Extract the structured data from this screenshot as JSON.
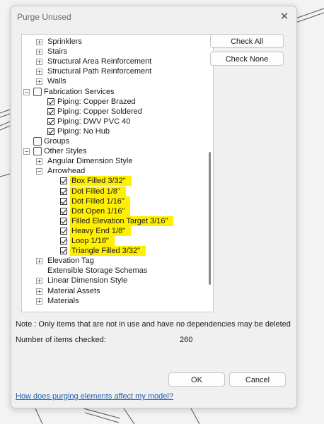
{
  "dialog": {
    "title": "Purge Unused",
    "close_glyph": "✕",
    "buttons": {
      "check_all": "Check All",
      "check_none": "Check None",
      "ok": "OK",
      "cancel": "Cancel"
    },
    "note": "Note : Only items that are not in use and have no dependencies may be deleted",
    "count_label": "Number of items checked:",
    "count_value": "260",
    "help_link": "How does purging elements affect my model?",
    "highlight_color": "#ffef00"
  },
  "tree": {
    "items": [
      {
        "label": "Sprinklers",
        "level": 1,
        "expander": "+",
        "checkbox": "none",
        "icon": "",
        "highlight": false
      },
      {
        "label": "Stairs",
        "level": 1,
        "expander": "+",
        "checkbox": "none",
        "icon": "",
        "highlight": false
      },
      {
        "label": "Structural Area Reinforcement",
        "level": 1,
        "expander": "+",
        "checkbox": "none",
        "icon": "",
        "highlight": false
      },
      {
        "label": "Structural Path Reinforcement",
        "level": 1,
        "expander": "+",
        "checkbox": "none",
        "icon": "",
        "highlight": false
      },
      {
        "label": "Walls",
        "level": 1,
        "expander": "+",
        "checkbox": "none",
        "icon": "",
        "highlight": false
      },
      {
        "label": "Fabrication Services",
        "level": 0,
        "expander": "-",
        "checkbox": "none",
        "icon": "fabrication-icon",
        "highlight": false
      },
      {
        "label": "Piping: Copper Brazed",
        "level": 1,
        "expander": "",
        "checkbox": "checked",
        "icon": "",
        "highlight": false
      },
      {
        "label": "Piping: Copper Soldered",
        "level": 1,
        "expander": "",
        "checkbox": "checked",
        "icon": "",
        "highlight": false
      },
      {
        "label": "Piping: DWV PVC 40",
        "level": 1,
        "expander": "",
        "checkbox": "checked",
        "icon": "",
        "highlight": false
      },
      {
        "label": "Piping: No Hub",
        "level": 1,
        "expander": "",
        "checkbox": "checked",
        "icon": "",
        "highlight": false
      },
      {
        "label": "Groups",
        "level": 0,
        "expander": "",
        "checkbox": "none",
        "icon": "groups-icon",
        "highlight": false
      },
      {
        "label": "Other Styles",
        "level": 0,
        "expander": "-",
        "checkbox": "none",
        "icon": "styles-icon",
        "highlight": false
      },
      {
        "label": "Angular Dimension Style",
        "level": 1,
        "expander": "+",
        "checkbox": "none",
        "icon": "",
        "highlight": false
      },
      {
        "label": "Arrowhead",
        "level": 1,
        "expander": "-",
        "checkbox": "none",
        "icon": "",
        "highlight": false
      },
      {
        "label": "Box Filled 3/32\"",
        "level": 2,
        "expander": "",
        "checkbox": "checked",
        "icon": "",
        "highlight": true
      },
      {
        "label": "Dot Filled 1/8\"",
        "level": 2,
        "expander": "",
        "checkbox": "checked",
        "icon": "",
        "highlight": true
      },
      {
        "label": "Dot Filled 1/16\"",
        "level": 2,
        "expander": "",
        "checkbox": "checked",
        "icon": "",
        "highlight": true
      },
      {
        "label": "Dot Open 1/16\"",
        "level": 2,
        "expander": "",
        "checkbox": "checked",
        "icon": "",
        "highlight": true
      },
      {
        "label": "Filled Elevation Target 3/16\"",
        "level": 2,
        "expander": "",
        "checkbox": "checked",
        "icon": "",
        "highlight": true
      },
      {
        "label": "Heavy End 1/8\"",
        "level": 2,
        "expander": "",
        "checkbox": "checked",
        "icon": "",
        "highlight": true
      },
      {
        "label": "Loop 1/16\"",
        "level": 2,
        "expander": "",
        "checkbox": "checked",
        "icon": "",
        "highlight": true
      },
      {
        "label": "Triangle Filled 3/32\"",
        "level": 2,
        "expander": "",
        "checkbox": "checked",
        "icon": "",
        "highlight": true
      },
      {
        "label": "Elevation Tag",
        "level": 1,
        "expander": "+",
        "checkbox": "none",
        "icon": "",
        "highlight": false
      },
      {
        "label": "Extensible Storage Schemas",
        "level": 1,
        "expander": "",
        "checkbox": "none",
        "icon": "",
        "highlight": false
      },
      {
        "label": "Linear Dimension Style",
        "level": 1,
        "expander": "+",
        "checkbox": "none",
        "icon": "",
        "highlight": false
      },
      {
        "label": "Material Assets",
        "level": 1,
        "expander": "+",
        "checkbox": "none",
        "icon": "",
        "highlight": false
      },
      {
        "label": "Materials",
        "level": 1,
        "expander": "+",
        "checkbox": "none",
        "icon": "",
        "highlight": false
      }
    ]
  }
}
